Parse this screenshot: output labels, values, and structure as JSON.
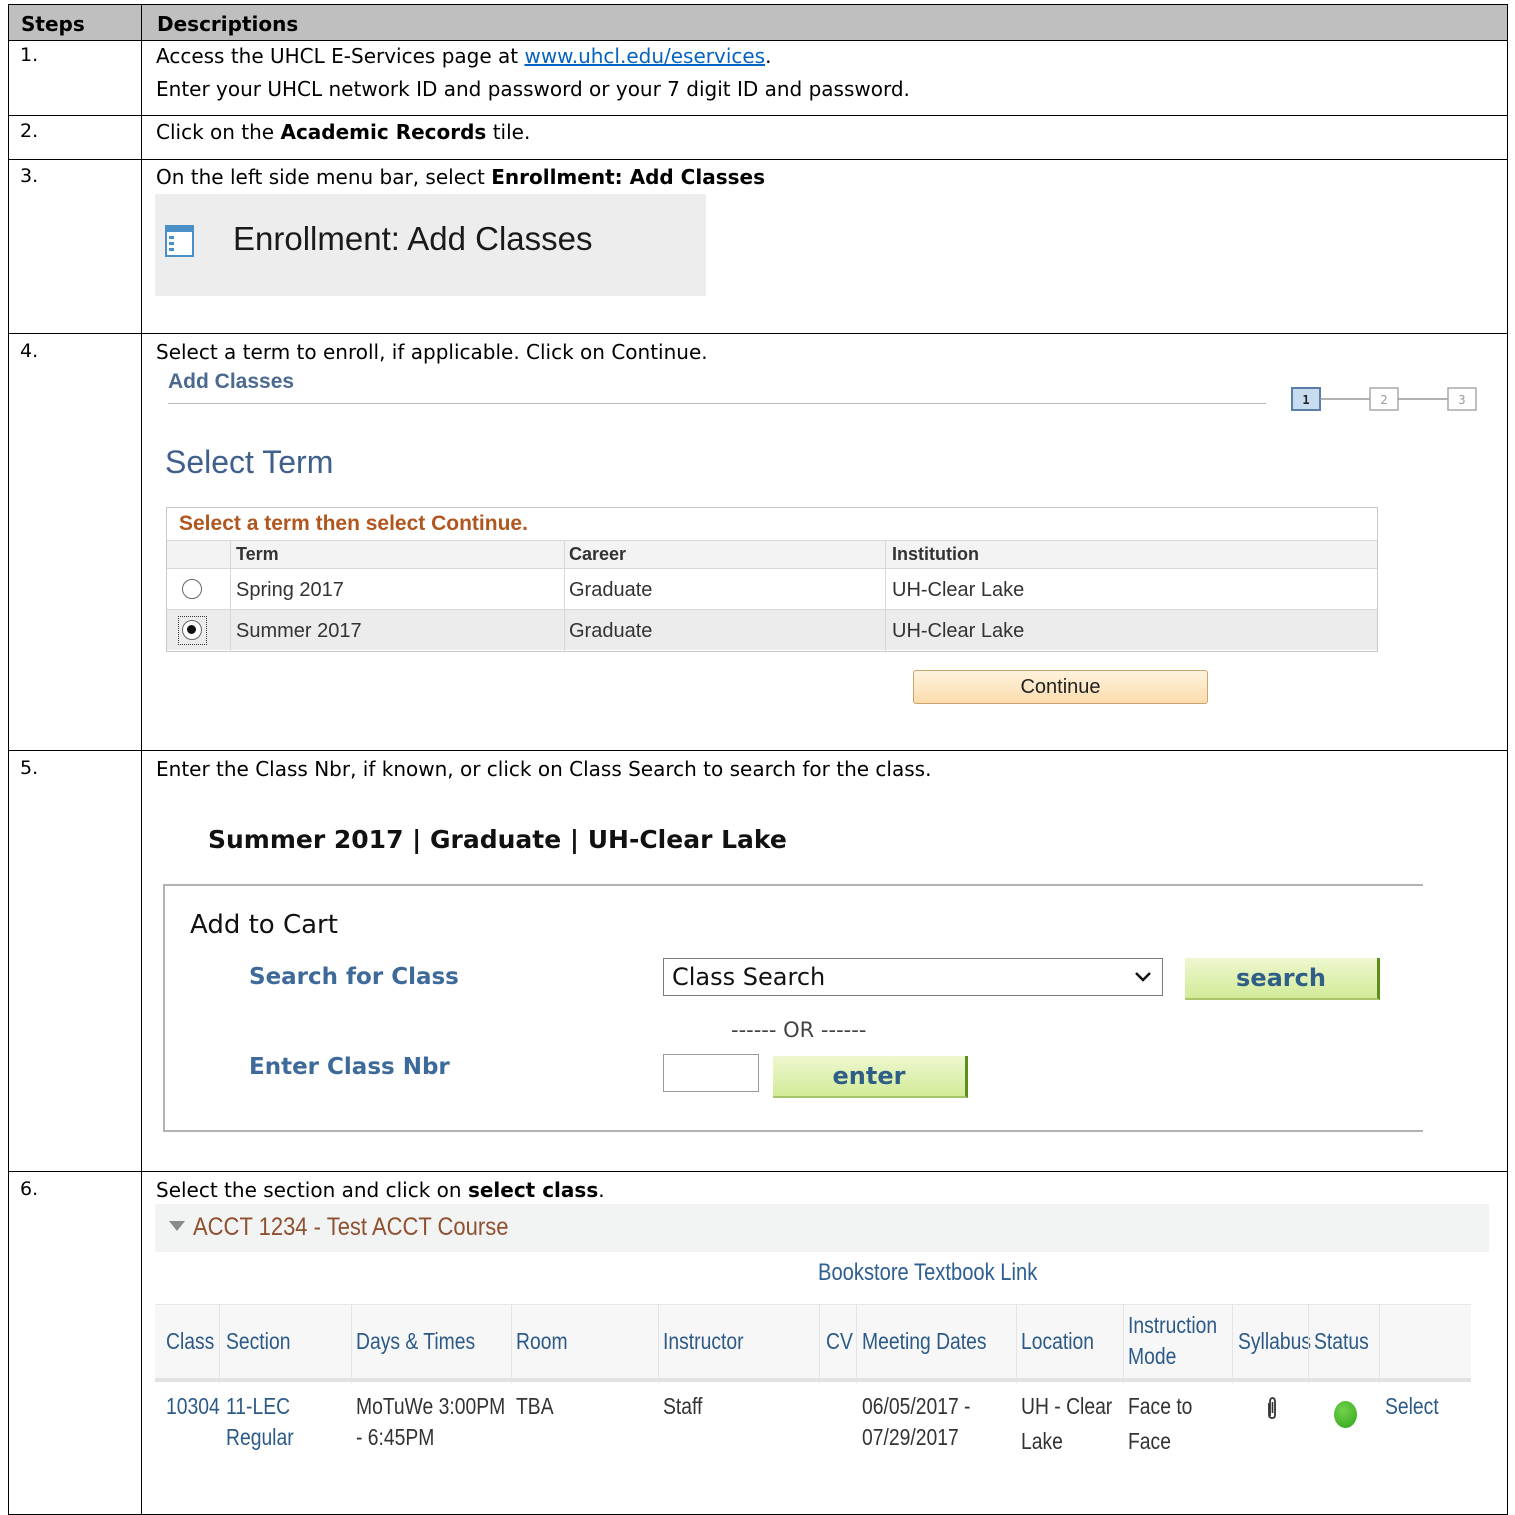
{
  "table": {
    "headers": {
      "steps": "Steps",
      "descriptions": "Descriptions"
    },
    "steps": [
      {
        "num": "1.",
        "lines": [
          "Access the UHCL E-Services page at ",
          "www.uhcl.edu/eservices",
          ".",
          "Enter your UHCL network ID and password or your 7 digit ID and password."
        ]
      },
      {
        "num": "2.",
        "pre": "Click on the ",
        "bold": "Academic Records",
        "post": " tile."
      },
      {
        "num": "3.",
        "pre": "On the left side menu bar, select ",
        "bold": "Enrollment: Add Classes"
      },
      {
        "num": "4.",
        "text": "Select a term to enroll, if applicable. Click on Continue."
      },
      {
        "num": "5.",
        "text": "Enter the Class Nbr, if known, or click on Class Search to search for the class."
      },
      {
        "num": "6.",
        "pre": "Select the section and click on ",
        "bold": "select class",
        "post": "."
      }
    ]
  },
  "step3_shot": {
    "label": "Enrollment:  Add Classes",
    "icon": "window-menu-icon"
  },
  "step4_shot": {
    "page_title": "Add Classes",
    "step_indicator": [
      "1",
      "2",
      "3"
    ],
    "heading": "Select Term",
    "grid_caption": "Select a term then select Continue.",
    "columns": [
      "Term",
      "Career",
      "Institution"
    ],
    "rows": [
      {
        "term": "Spring 2017",
        "career": "Graduate",
        "institution": "UH-Clear Lake",
        "selected": false
      },
      {
        "term": "Summer 2017",
        "career": "Graduate",
        "institution": "UH-Clear Lake",
        "selected": true
      }
    ],
    "continue_label": "Continue",
    "colors": {
      "caption": "#b0561f",
      "title": "#3f5f8d"
    }
  },
  "step5_shot": {
    "term_summary": "Summer 2017 | Graduate | UH-Clear Lake",
    "box_title": "Add to Cart",
    "search_label": "Search for Class",
    "search_select_value": "Class Search",
    "search_button": "search",
    "or_text": "------ OR ------",
    "nbr_label": "Enter Class Nbr",
    "nbr_value": "",
    "enter_button": "enter",
    "colors": {
      "label": "#3d6a9a",
      "button_border": "#5c8e1e"
    }
  },
  "step6_shot": {
    "course_title": "ACCT 1234 - Test ACCT Course",
    "bookstore_link": "Bookstore Textbook Link",
    "columns": {
      "class": "Class",
      "section": "Section",
      "days_times": "Days & Times",
      "room": "Room",
      "instructor": "Instructor",
      "cv": "CV",
      "meeting_dates": "Meeting Dates",
      "location": "Location",
      "instruction_mode_1": "Instruction",
      "instruction_mode_2": "Mode",
      "syllabus": "Syllabus",
      "status": "Status"
    },
    "row": {
      "class": "10304",
      "section_1": "11-LEC",
      "section_2": "Regular",
      "days_times_1": "MoTuWe 3:00PM",
      "days_times_2": "- 6:45PM",
      "room": "TBA",
      "instructor": "Staff",
      "meeting_dates_1": "06/05/2017 -",
      "meeting_dates_2": "07/29/2017",
      "location_1": "UH - Clear",
      "location_2": "Lake",
      "mode_1": "Face to",
      "mode_2": "Face",
      "syllabus_icon": "paperclip-icon",
      "status_icon": "open-status-icon",
      "status_color": "#2ea51a",
      "action": "Select"
    }
  }
}
